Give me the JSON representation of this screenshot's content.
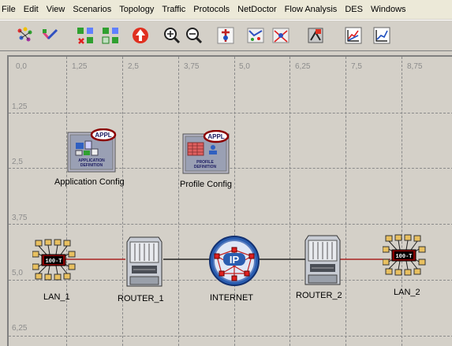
{
  "menu": [
    "File",
    "Edit",
    "View",
    "Scenarios",
    "Topology",
    "Traffic",
    "Protocols",
    "NetDoctor",
    "Flow Analysis",
    "DES",
    "Windows"
  ],
  "toolbar": {
    "buttons": [
      "open-object-palette-icon",
      "verify-links-icon",
      "fail-node-icon",
      "recover-node-icon",
      "return-to-parent-icon",
      "zoom-in-icon",
      "zoom-out-icon",
      "configure-simulation-icon",
      "view-results-icon",
      "hide-statistics-icon",
      "view-web-report-icon",
      "results-graph-icon",
      "analysis-graph-icon"
    ]
  },
  "grid": {
    "x_ticks": [
      "0,0",
      "1,25",
      "2,5",
      "3,75",
      "5,0",
      "6,25",
      "7,5",
      "8,75"
    ],
    "y_ticks": [
      "1,25",
      "2,5",
      "3,75",
      "5,0",
      "6,25"
    ]
  },
  "nodes": {
    "app_config": {
      "label": "Application Config",
      "badge": "APPL",
      "caption1": "APPLICATION",
      "caption2": "DEFINITION"
    },
    "profile_config": {
      "label": "Profile Config",
      "badge": "APPL",
      "caption1": "PROFILE",
      "caption2": "DEFINITION"
    },
    "lan1": {
      "label": "LAN_1",
      "badge": "100-T"
    },
    "router1": {
      "label": "ROUTER_1"
    },
    "internet": {
      "label": "INTERNET",
      "badge": "IP"
    },
    "router2": {
      "label": "ROUTER_2"
    },
    "lan2": {
      "label": "LAN_2",
      "badge": "100-T"
    }
  },
  "colors": {
    "link_red": "#a00000",
    "link_black": "#000000",
    "accent_red": "#8b0000",
    "ip_blue": "#2a5db0"
  }
}
